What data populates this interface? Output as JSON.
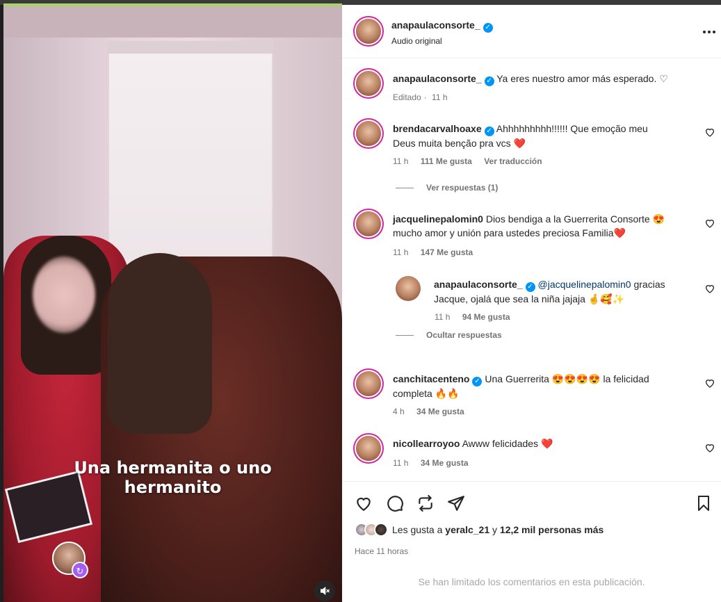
{
  "media": {
    "caption_line1": "Una hermanita o uno",
    "caption_line2": "hermanito"
  },
  "header": {
    "username": "anapaulaconsorte_",
    "subtitle": "Audio original",
    "more_icon": "more-horizontal-icon"
  },
  "caption_post": {
    "username": "anapaulaconsorte_",
    "text": "Ya eres nuestro amor más esperado. ♡",
    "edited": "Editado",
    "time": "11 h"
  },
  "comments": [
    {
      "username": "brendacarvalhoaxe",
      "text_line1": "Ahhhhhhhhh!!!!!! Que emoção meu",
      "text_line2": "Deus muita benção pra vcs ❤️",
      "time": "11 h",
      "likes": "111 Me gusta",
      "translate": "Ver traducción",
      "replies": "Ver respuestas (1)"
    },
    {
      "username": "jacquelinepalomin0",
      "text_line1": "Dios bendiga a la Guerrerita Consorte 😍",
      "text_line2": "mucho amor y unión para ustedes preciosa Familia❤️",
      "time": "11 h",
      "likes": "147 Me gusta",
      "reply": {
        "username": "anapaulaconsorte_",
        "mention": "@jacquelinepalomin0",
        "text_line1_rest": " gracias",
        "text_line2": "Jacque, ojalá que sea la niña jajaja 🤞🥰✨",
        "time": "11 h",
        "likes": "94 Me gusta"
      },
      "hide_replies": "Ocultar respuestas"
    },
    {
      "username": "canchitacenteno",
      "text_line1": "Una Guerrerita 😍😍😍😍 la felicidad",
      "text_line2": "completa 🔥🔥",
      "time": "4 h",
      "likes": "34 Me gusta"
    },
    {
      "username": "nicollearroyoo",
      "text_line1": "Awww felicidades ❤️",
      "time": "11 h",
      "likes": "34 Me gusta"
    }
  ],
  "actions": {
    "like_icon": "heart-icon",
    "comment_icon": "comment-icon",
    "repost_icon": "repost-icon",
    "share_icon": "send-icon",
    "save_icon": "bookmark-icon"
  },
  "likes_summary": {
    "prefix": "Les gusta a",
    "user": "yeralc_21",
    "joiner": "y",
    "count": "12,2 mil personas más"
  },
  "post_time": "Hace 11 horas",
  "comments_limited": "Se han limitado los comentarios en esta publicación.",
  "colors": {
    "verified": "#0095f6",
    "mention": "#00376b",
    "muted": "#737373"
  }
}
